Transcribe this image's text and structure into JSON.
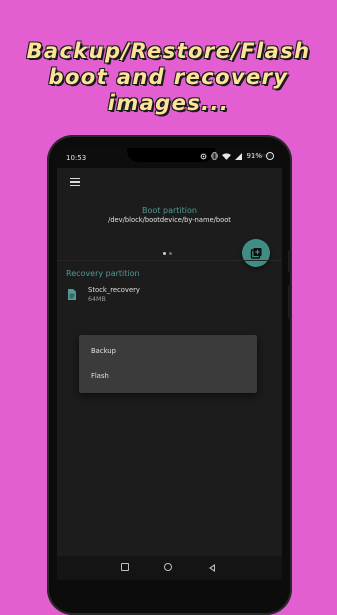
{
  "headline": {
    "lines": [
      "Backup/Restore/Flash",
      "boot and recovery",
      "images..."
    ]
  },
  "status_bar": {
    "time": "10:53",
    "battery": "91%"
  },
  "app_bar": {
    "menu_icon": "hamburger-menu-icon"
  },
  "boot_partition": {
    "title": "Boot partition",
    "path": "/dev/block/bootdevice/by-name/boot",
    "page_count": 2,
    "active_page": 0
  },
  "fab": {
    "icon": "add-library-icon"
  },
  "recovery_partition": {
    "title": "Recovery partition",
    "files": [
      {
        "name": "Stock_recovery",
        "size": "64MB",
        "icon": "file-icon"
      }
    ]
  },
  "context_menu": {
    "items": [
      "Backup",
      "Flash"
    ]
  },
  "colors": {
    "accent": "#3f8e85",
    "section_title": "#4f9b95",
    "background": "#e35fd1",
    "headline_text": "#fde39a"
  }
}
